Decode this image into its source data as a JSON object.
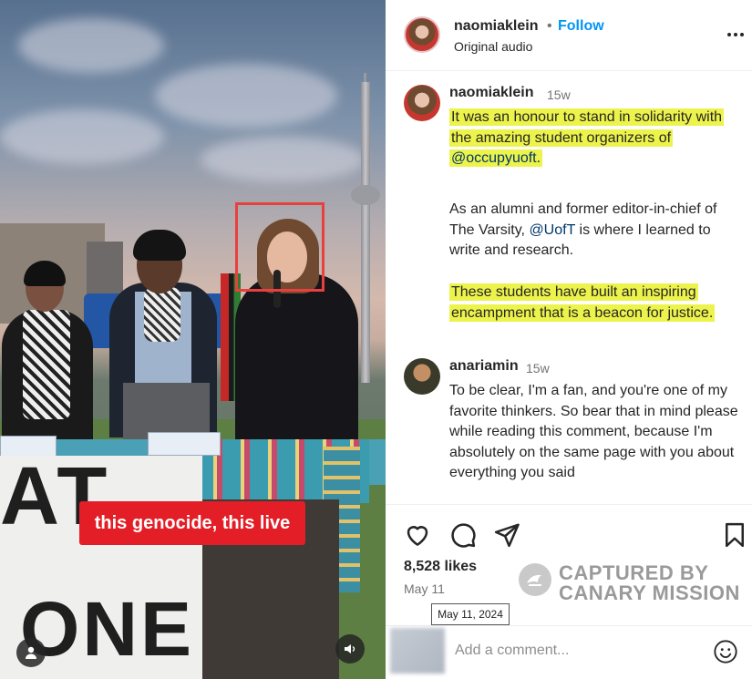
{
  "video": {
    "caption": "this genocide, this live",
    "banner_top": "AT",
    "banner_bottom": "ONE",
    "icons": {
      "user": "user-icon",
      "audio": "speaker-icon"
    }
  },
  "header": {
    "username": "naomiaklein",
    "dot": "•",
    "follow_label": "Follow",
    "audio_label": "Original audio",
    "more_icon": "more-options-icon"
  },
  "comments": [
    {
      "username": "naomiaklein",
      "time": "15w",
      "p1_a": "It was an honour to stand in solidarity with the amazing student organizers of ",
      "p1_mention": "@occupyuoft",
      "p1_b": ".",
      "p2_a": "As an alumni and former editor-in-chief of The Varsity, ",
      "p2_mention": "@UofT",
      "p2_b": " is where I learned to write and research.",
      "p3": "These students have built an inspiring encampment that is a beacon for justice."
    },
    {
      "username": "anariamin",
      "time": "15w",
      "text": "To be clear, I'm a fan, and you're one of my favorite thinkers. So bear that in mind please while reading this comment, because I'm absolutely on the same page with you about everything you said"
    }
  ],
  "actions": {
    "icons": [
      "heart-icon",
      "comment-icon",
      "share-icon",
      "bookmark-icon"
    ],
    "likes": "8,528 likes",
    "date": "May 11",
    "tooltip": "May 11, 2024"
  },
  "watermark": {
    "line1": "CAPTURED BY",
    "line2": "CANARY MISSION"
  },
  "add_comment": {
    "placeholder": "Add a comment...",
    "emoji_icon": "emoji-icon"
  },
  "colors": {
    "follow": "#0095f6",
    "highlight": "#ecf34b",
    "caption_bg": "#e41e26",
    "box": "#e8403f"
  }
}
